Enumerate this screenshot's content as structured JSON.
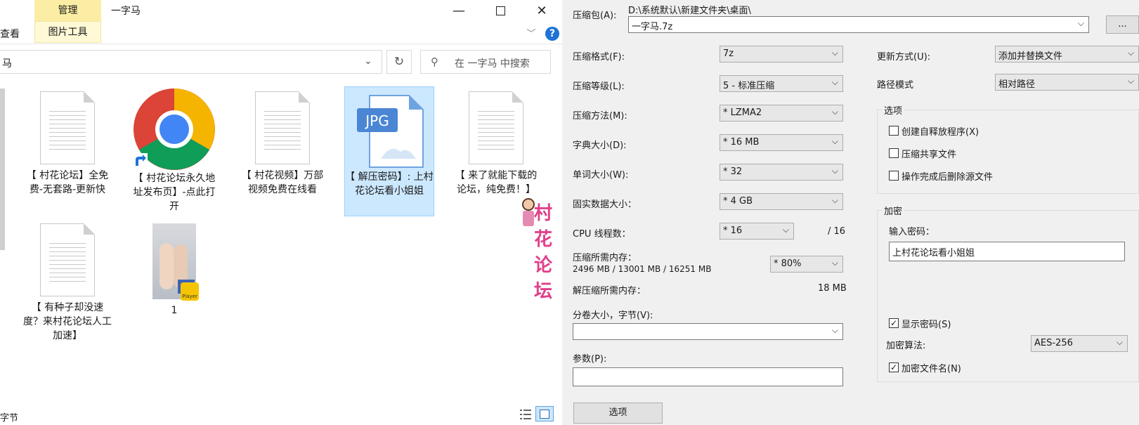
{
  "explorer": {
    "ribbon": {
      "manage_tab": "管理",
      "picture_tools_tab": "图片工具",
      "view_tab": "查看",
      "window_title": "一字马"
    },
    "address": "马",
    "search_placeholder": "在 一字马 中搜索",
    "files": [
      {
        "name": "【 村花论坛】全免费-无套路-更新快",
        "icon": "text-document-icon"
      },
      {
        "name": "【 村花论坛永久地址发布页】-点此打开",
        "icon": "chrome-icon"
      },
      {
        "name": "【 村花视频】万部视频免费在线看",
        "icon": "text-document-icon"
      },
      {
        "name": "【 解压密码】: 上村花论坛看小姐姐",
        "icon": "jpg-file-icon",
        "selected": true
      },
      {
        "name": "【 来了就能下载的论坛，纯免费！】",
        "icon": "text-document-icon"
      },
      {
        "name": "【 有种子却没速度？来村花论坛人工加速】",
        "icon": "text-document-icon"
      },
      {
        "name": "1",
        "icon": "video-thumbnail-icon"
      }
    ],
    "jpg_badge": "JPG",
    "player_badge": "Player",
    "status_size": "字节"
  },
  "dialog": {
    "archive_label": "压缩包(A):",
    "archive_path": "D:\\系统默认\\新建文件夹\\桌面\\",
    "archive_name": "一字马.7z",
    "browse_btn": "...",
    "format_label": "压缩格式(F):",
    "format_value": "7z",
    "level_label": "压缩等级(L):",
    "level_value": "5 - 标准压缩",
    "method_label": "压缩方法(M):",
    "method_value": "* LZMA2",
    "dict_label": "字典大小(D):",
    "dict_value": "* 16 MB",
    "word_label": "单词大小(W):",
    "word_value": "* 32",
    "solid_label": "固实数据大小：",
    "solid_value": "* 4 GB",
    "cpu_label": "CPU 线程数：",
    "cpu_value": "* 16",
    "cpu_max": "/ 16",
    "mem_label": "压缩所需内存：",
    "mem_detail": "2496 MB / 13001 MB / 16251 MB",
    "mem_value": "* 80%",
    "decomp_label": "解压缩所需内存：",
    "decomp_value": "18 MB",
    "volume_label": "分卷大小，字节(V):",
    "params_label": "参数(P):",
    "options_btn": "选项",
    "update_label": "更新方式(U):",
    "update_value": "添加并替换文件",
    "path_label": "路径模式",
    "path_value": "相对路径",
    "options_group": "选项",
    "opt_sfx": "创建自释放程序(X)",
    "opt_shared": "压缩共享文件",
    "opt_delete": "操作完成后删除源文件",
    "encrypt_group": "加密",
    "password_label": "输入密码：",
    "password_value": "上村花论坛看小姐姐",
    "show_password": "显示密码(S)",
    "enc_method_label": "加密算法:",
    "enc_method_value": "AES-256",
    "encrypt_names": "加密文件名(N)"
  },
  "watermark": "村花论坛"
}
